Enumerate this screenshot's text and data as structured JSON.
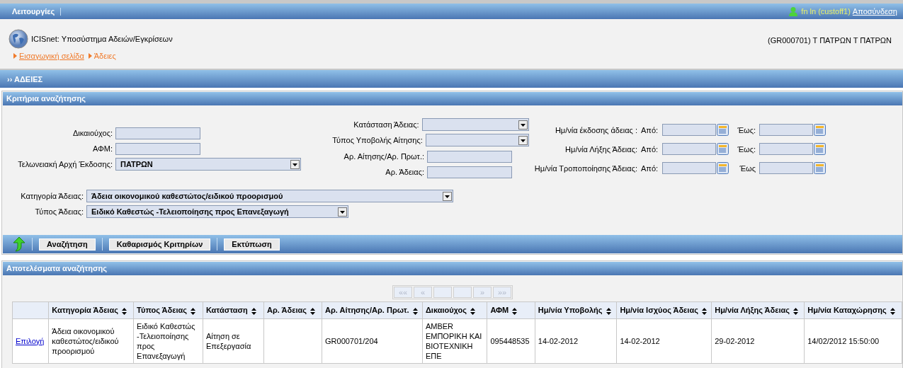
{
  "top_bar": {
    "menu": "Λειτουργίες",
    "user": "fn ln (custoff1)",
    "logout": "Αποσύνδεση"
  },
  "header": {
    "app_title": "ICISnet: Υποσύστημα Αδειών/Εγκρίσεων",
    "office": "(GR000701) Τ ΠΑΤΡΩΝ  Τ ΠΑΤΡΩΝ",
    "breadcrumb": [
      {
        "label": "Εισαγωγική σελίδα",
        "link": true
      },
      {
        "label": "Άδειες",
        "link": false
      }
    ]
  },
  "section_bar": {
    "title": "›› ΑΔΕΙΕΣ"
  },
  "criteria": {
    "title": "Κριτήρια αναζήτησης",
    "left_fields": [
      {
        "label": "Δικαιούχος:",
        "kind": "text"
      },
      {
        "label": "ΑΦΜ:",
        "kind": "text"
      },
      {
        "label": "Τελωνειακή Αρχή Έκδοσης:",
        "kind": "select",
        "value": "ΠΑΤΡΩΝ"
      }
    ],
    "middle_fields": [
      {
        "label": "Κατάσταση Άδειας:",
        "kind": "select"
      },
      {
        "label": "Τύπος Υποβολής Αίτησης:",
        "kind": "select"
      },
      {
        "label": "Αρ. Αίτησης/Αρ. Πρωτ.:",
        "kind": "text"
      },
      {
        "label": "Αρ. Άδειας:",
        "kind": "text"
      }
    ],
    "date_rows": [
      {
        "label": "Ημ/νία έκδοσης άδειας :",
        "from_label": "Από:",
        "to_label": "Έως:"
      },
      {
        "label": "Ημ/νία Λήξης Άδειας:",
        "from_label": "Από:",
        "to_label": "Έως:"
      },
      {
        "label": "Ημ/νία Τροποποίησης Άδειας:",
        "from_label": "Από:",
        "to_label": "Έως"
      }
    ],
    "wide_fields": [
      {
        "label": "Κατηγορία Άδειας:",
        "kind": "select",
        "value": "Άδεια οικονομικού καθεστώτος/ειδικού προορισμού"
      },
      {
        "label": "Τύπος Άδειας:",
        "kind": "select",
        "value": "Ειδικό Καθεστώς -Τελειοποίησης προς Επανεξαγωγή"
      }
    ]
  },
  "toolbar": {
    "buttons": [
      "Αναζήτηση",
      "Καθαρισμός Κριτηρίων",
      "Εκτύπωση"
    ]
  },
  "results": {
    "title": "Αποτελέσματα αναζήτησης",
    "pager": {
      "first": "««",
      "prev": "«",
      "next": "»",
      "last": "»»",
      "disabled": true
    },
    "columns": [
      "Κατηγορία Άδειας",
      "Τύπος Άδειας",
      "Κατάσταση",
      "Αρ. Άδειας",
      "Αρ. Αίτησης/Αρ. Πρωτ.",
      "Δικαιούχος",
      "ΑΦΜ",
      "Ημ/νία Υποβολής",
      "Ημ/νία Ισχύος Άδειας",
      "Ημ/νία Λήξης Άδειας",
      "Ημ/νία Καταχώρησης"
    ],
    "rows": [
      {
        "action": "Επιλογή",
        "cells": [
          "Άδεια οικονομικού καθεστώτος/ειδικού προορισμού",
          "Ειδικό Καθεστώς -Τελειοποίησης προς Επανεξαγωγή",
          "Αίτηση σε Επεξεργασία",
          "",
          "GR000701/204",
          "AMBER ΕΜΠΟΡΙΚΗ ΚΑΙ ΒΙΟΤΕΧΝΙΚΗ ΕΠΕ",
          "095448535",
          "14-02-2012",
          "14-02-2012",
          "29-02-2012",
          "14/02/2012 15:50:00"
        ]
      }
    ]
  }
}
